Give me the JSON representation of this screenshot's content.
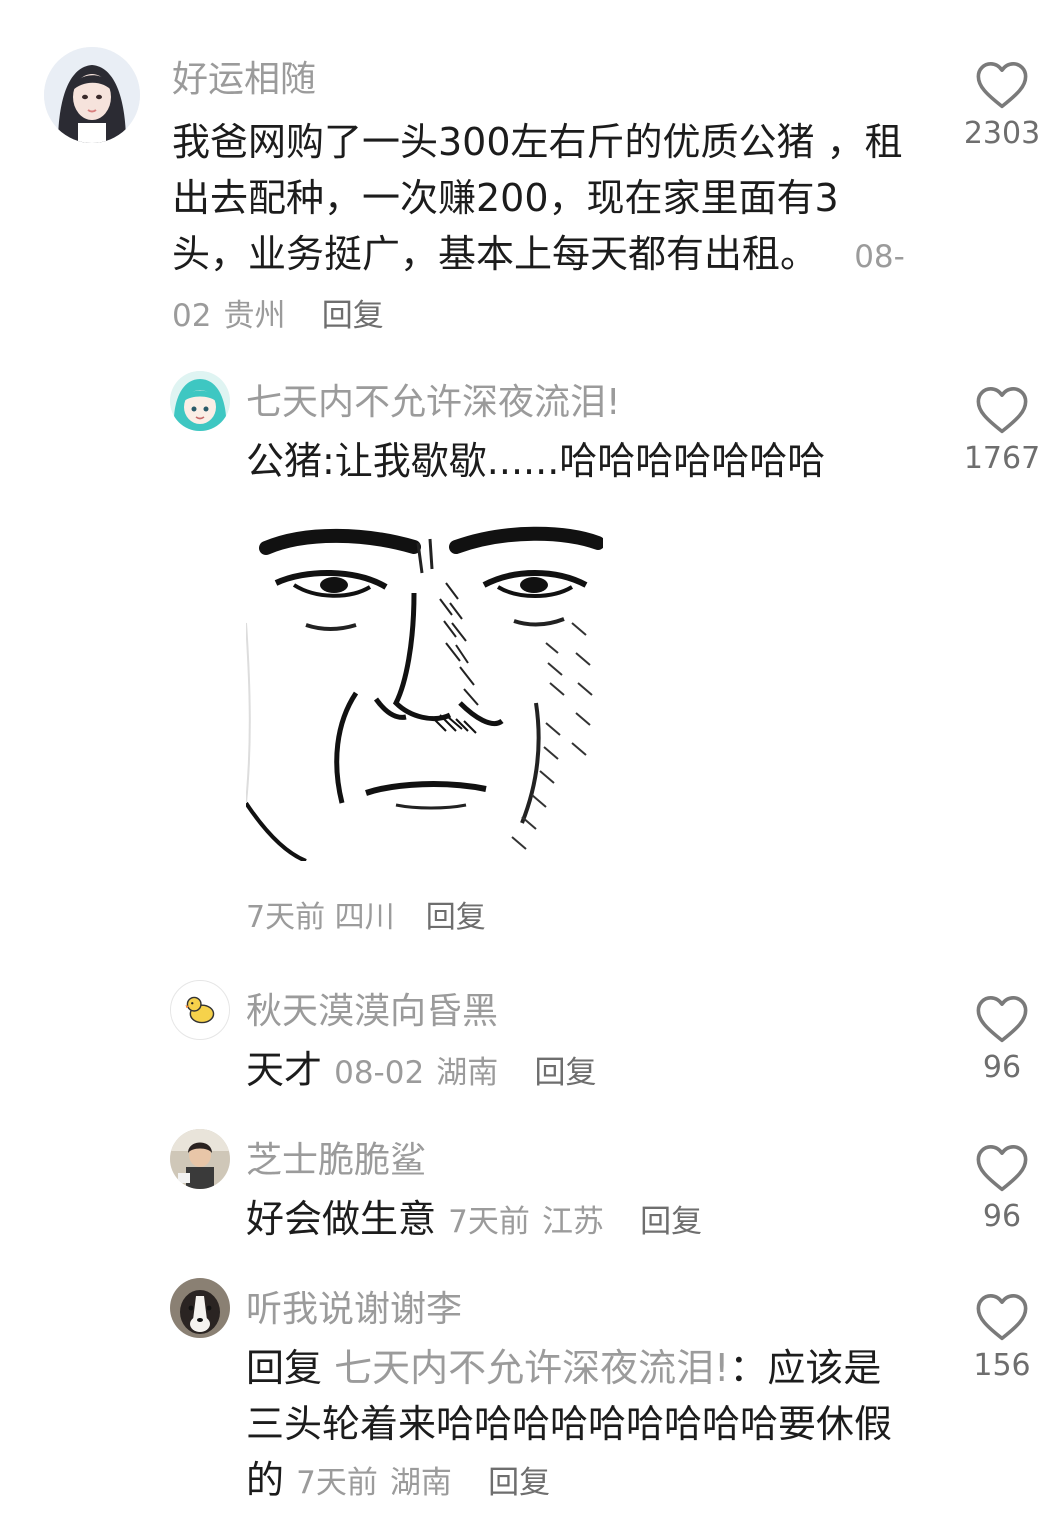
{
  "comments": [
    {
      "username": "好运相随",
      "text": "我爸网购了一头300左右斤的优质公猪 ，租出去配种，一次赚200，现在家里面有3头，业务挺广，基本上每天都有出租。",
      "date": "08-02",
      "location": "贵州",
      "reply_label": "回复",
      "likes": "2303"
    },
    {
      "username": "七天内不允许深夜流泪!",
      "text": "公猪:让我歇歇......哈哈哈哈哈哈哈",
      "date": "7天前",
      "location": "四川",
      "reply_label": "回复",
      "likes": "1767"
    },
    {
      "username": "秋天漠漠向昏黑",
      "text": "天才",
      "date": "08-02",
      "location": "湖南",
      "reply_label": "回复",
      "likes": "96"
    },
    {
      "username": "芝士脆脆鲨",
      "text": "好会做生意",
      "date": "7天前",
      "location": "江苏",
      "reply_label": "回复",
      "likes": "96"
    },
    {
      "username": "听我说谢谢李",
      "reply_prefix": "回复",
      "reply_to": "七天内不允许深夜流泪!",
      "reply_colon": "：",
      "text": "应该是三头轮着来哈哈哈哈哈哈哈哈哈要休假的",
      "date": "7天前",
      "location": "湖南",
      "reply_label": "回复",
      "likes": "156"
    }
  ],
  "icons": {
    "like": "heart-outline-icon"
  },
  "colors": {
    "username": "#9b9b9b",
    "body_text": "#1c1c1c",
    "meta": "#9b9b9b",
    "icon": "#7a7a7a"
  }
}
